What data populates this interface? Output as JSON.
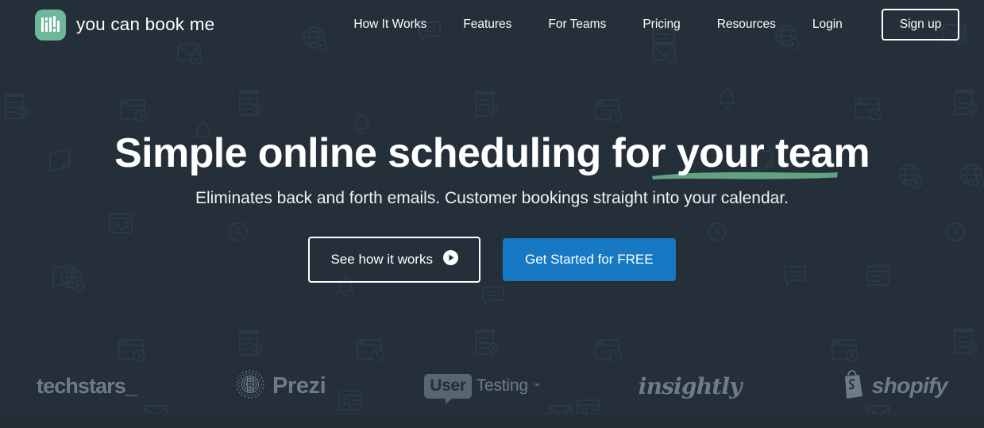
{
  "brand": {
    "name": "you can book me",
    "logo_icon": "bar-chart-logo-icon",
    "logo_bg_color": "#6fb79a"
  },
  "header": {
    "nav_items": [
      {
        "label": "How It Works",
        "name": "nav-how-it-works"
      },
      {
        "label": "Features",
        "name": "nav-features"
      },
      {
        "label": "For Teams",
        "name": "nav-for-teams"
      },
      {
        "label": "Pricing",
        "name": "nav-pricing"
      },
      {
        "label": "Resources",
        "name": "nav-resources"
      },
      {
        "label": "Login",
        "name": "nav-login"
      }
    ],
    "signup_label": "Sign up"
  },
  "hero": {
    "title": "Simple online scheduling for your team",
    "title_highlight": "your team",
    "underline_color": "#5fa385",
    "subtitle": "Eliminates back and forth emails. Customer bookings straight into your calendar.",
    "primary_cta": {
      "label": "Get Started for FREE",
      "color": "#1779c4"
    },
    "secondary_cta": {
      "label": "See how it works",
      "icon": "play-circle-icon"
    }
  },
  "client_logos": [
    {
      "name": "techstars",
      "label": "techstars_"
    },
    {
      "name": "prezi",
      "label": "Prezi"
    },
    {
      "name": "usertesting",
      "label_bubble": "User",
      "label_rest": "Testing",
      "trademark": "™"
    },
    {
      "name": "insightly",
      "label": "insightly"
    },
    {
      "name": "shopify",
      "label": "shopify"
    }
  ],
  "colors": {
    "background": "#242f39",
    "accent_green": "#6fb79a",
    "accent_blue": "#1779c4",
    "logo_grey": "#6f7c88"
  }
}
